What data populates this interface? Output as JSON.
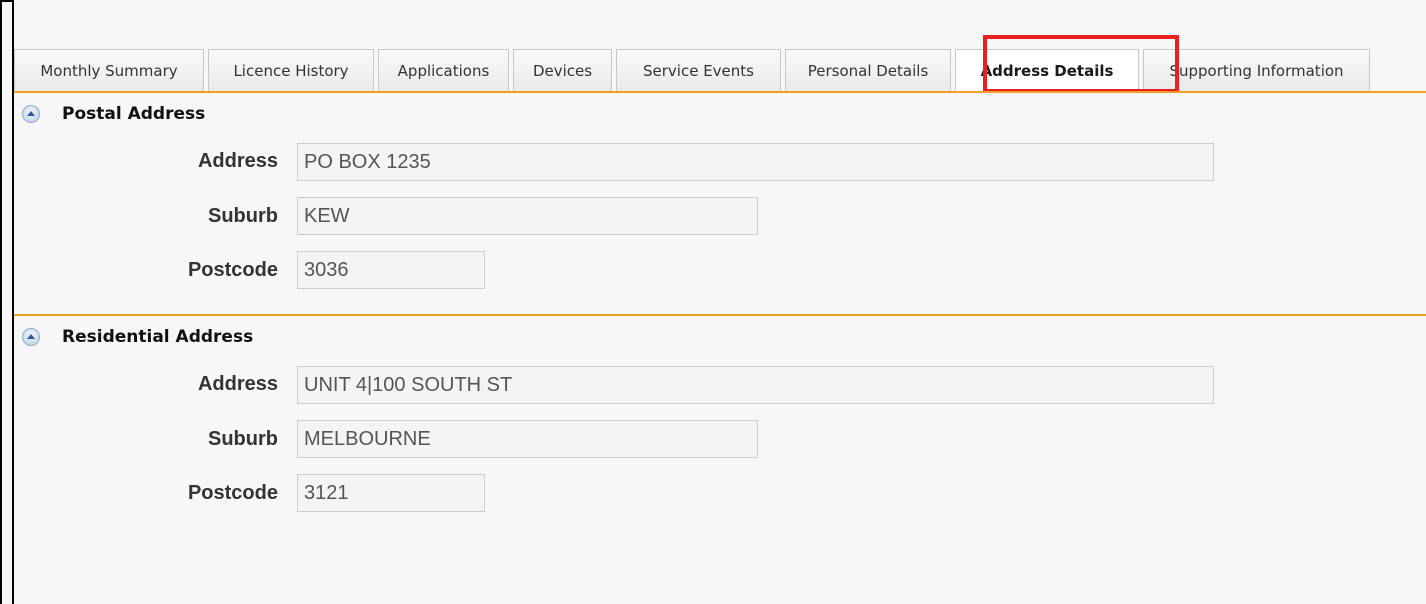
{
  "tabs": [
    {
      "label": "Monthly Summary",
      "active": false
    },
    {
      "label": "Licence History",
      "active": false
    },
    {
      "label": "Applications",
      "active": false
    },
    {
      "label": "Devices",
      "active": false
    },
    {
      "label": "Service Events",
      "active": false
    },
    {
      "label": "Personal Details",
      "active": false
    },
    {
      "label": "Address Details",
      "active": true
    },
    {
      "label": "Supporting Information",
      "active": false
    }
  ],
  "postal": {
    "title": "Postal Address",
    "address_label": "Address",
    "address_value": "PO BOX 1235",
    "suburb_label": "Suburb",
    "suburb_value": "KEW",
    "postcode_label": "Postcode",
    "postcode_value": "3036"
  },
  "residential": {
    "title": "Residential Address",
    "address_label": "Address",
    "address_value": "UNIT 4|100 SOUTH ST",
    "suburb_label": "Suburb",
    "suburb_value": "MELBOURNE",
    "postcode_label": "Postcode",
    "postcode_value": "3121"
  },
  "colors": {
    "accent": "#f0a028",
    "highlight": "#e8201e"
  }
}
